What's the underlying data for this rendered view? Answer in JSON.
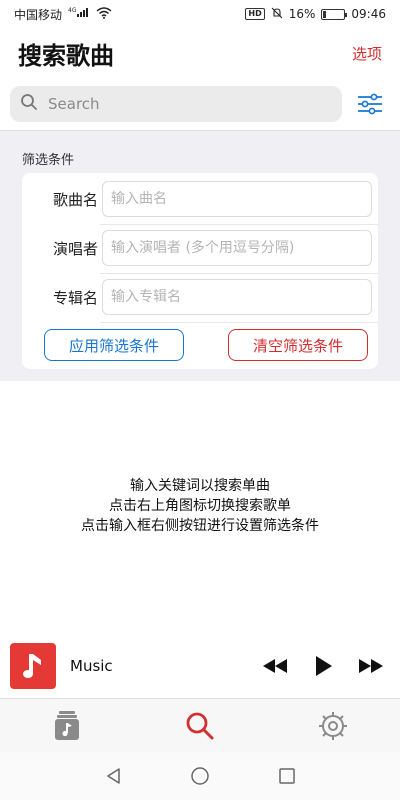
{
  "status_bar": {
    "carrier": "中国移动",
    "network": "4G",
    "battery_percent": "16%",
    "battery_level": 0.16,
    "time": "09:46",
    "icons": [
      "signal-icon",
      "wifi-icon",
      "hd-icon",
      "mute-icon",
      "battery-icon"
    ]
  },
  "header": {
    "title": "搜索歌曲",
    "options_label": "选项"
  },
  "search": {
    "placeholder": "Search",
    "value": ""
  },
  "filter": {
    "heading": "筛选条件",
    "fields": [
      {
        "label": "歌曲名",
        "placeholder": "输入曲名"
      },
      {
        "label": "演唱者",
        "placeholder": "输入演唱者 (多个用逗号分隔)"
      },
      {
        "label": "专辑名",
        "placeholder": "输入专辑名"
      }
    ],
    "apply_label": "应用筛选条件",
    "clear_label": "清空筛选条件"
  },
  "hint": {
    "lines": [
      "输入关键词以搜索单曲",
      "点击右上角图标切换搜索歌单",
      "点击输入框右侧按钮进行设置筛选条件"
    ]
  },
  "player": {
    "track_title": "Music",
    "controls": [
      "rewind-icon",
      "play-icon",
      "fast-forward-icon"
    ]
  },
  "tabs": [
    {
      "name": "library",
      "icon": "music-library-icon",
      "active": false
    },
    {
      "name": "search",
      "icon": "search-icon",
      "active": true
    },
    {
      "name": "settings",
      "icon": "settings-gear-icon",
      "active": false
    }
  ],
  "colors": {
    "accent_red": "#d32f2f",
    "accent_blue": "#1976d2",
    "album_red": "#e53935"
  }
}
